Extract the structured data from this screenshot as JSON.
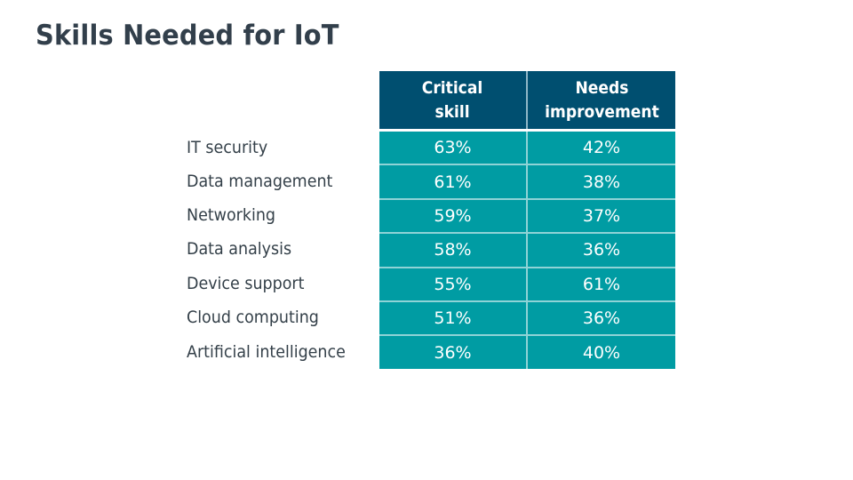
{
  "title": "Skills Needed for IoT",
  "table": {
    "headers": [
      {
        "line1": "Critical",
        "line2": "skill"
      },
      {
        "line1": "Needs",
        "line2": "improvement"
      }
    ],
    "rows": [
      {
        "label": "IT security",
        "critical": "63%",
        "needs": "42%"
      },
      {
        "label": "Data management",
        "critical": "61%",
        "needs": "38%"
      },
      {
        "label": "Networking",
        "critical": "59%",
        "needs": "37%"
      },
      {
        "label": "Data analysis",
        "critical": "58%",
        "needs": "36%"
      },
      {
        "label": "Device support",
        "critical": "55%",
        "needs": "61%"
      },
      {
        "label": "Cloud computing",
        "critical": "51%",
        "needs": "36%"
      },
      {
        "label": "Artificial intelligence",
        "critical": "36%",
        "needs": "40%"
      }
    ]
  },
  "colors": {
    "header_bg": "#004f70",
    "cell_bg": "#009ca3",
    "title_text": "#323f4b"
  }
}
